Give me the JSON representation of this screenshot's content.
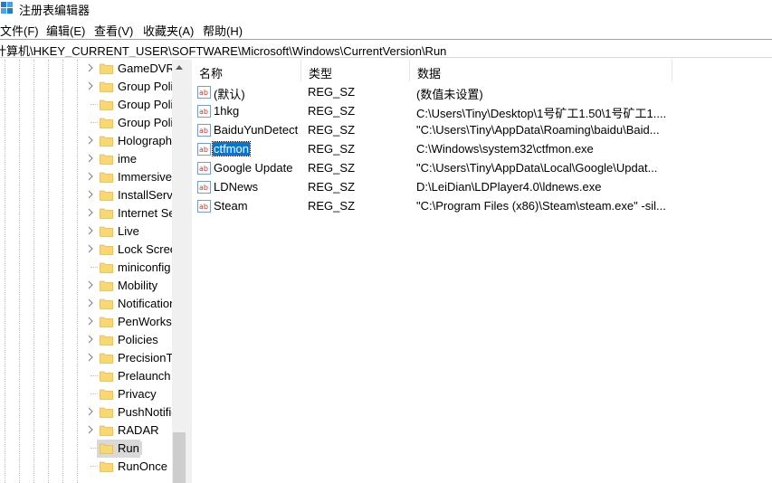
{
  "window": {
    "title": "注册表编辑器"
  },
  "menu": [
    "文件(F)",
    "编辑(E)",
    "查看(V)",
    "收藏夹(A)",
    "帮助(H)"
  ],
  "address": "计算机\\HKEY_CURRENT_USER\\SOFTWARE\\Microsoft\\Windows\\CurrentVersion\\Run",
  "tree": [
    {
      "label": "GameDVR",
      "expander": true
    },
    {
      "label": "Group Policy",
      "expander": true
    },
    {
      "label": "Group Policy",
      "expander": false
    },
    {
      "label": "Group Policy",
      "expander": false
    },
    {
      "label": "Holographic",
      "expander": true
    },
    {
      "label": "ime",
      "expander": true
    },
    {
      "label": "Immersive",
      "expander": true
    },
    {
      "label": "InstallService",
      "expander": true
    },
    {
      "label": "Internet Settings",
      "expander": true
    },
    {
      "label": "Live",
      "expander": true
    },
    {
      "label": "Lock Screen",
      "expander": true
    },
    {
      "label": "miniconfig",
      "expander": false
    },
    {
      "label": "Mobility",
      "expander": true
    },
    {
      "label": "Notifications",
      "expander": true
    },
    {
      "label": "PenWorkspace",
      "expander": true
    },
    {
      "label": "Policies",
      "expander": true
    },
    {
      "label": "PrecisionTouchPad",
      "expander": true
    },
    {
      "label": "Prelaunch",
      "expander": false
    },
    {
      "label": "Privacy",
      "expander": false
    },
    {
      "label": "PushNotifications",
      "expander": true
    },
    {
      "label": "RADAR",
      "expander": true
    },
    {
      "label": "Run",
      "expander": false,
      "selected": true
    },
    {
      "label": "RunOnce",
      "expander": false
    }
  ],
  "columns": {
    "name": "名称",
    "type": "类型",
    "data": "数据"
  },
  "values": [
    {
      "name": "(默认)",
      "type": "REG_SZ",
      "data": "(数值未设置)"
    },
    {
      "name": "1hkg",
      "type": "REG_SZ",
      "data": "C:\\Users\\Tiny\\Desktop\\1号矿工1.50\\1号矿工1...."
    },
    {
      "name": "BaiduYunDetect",
      "type": "REG_SZ",
      "data": "\"C:\\Users\\Tiny\\AppData\\Roaming\\baidu\\Baid..."
    },
    {
      "name": "ctfmon",
      "type": "REG_SZ",
      "data": "C:\\Windows\\system32\\ctfmon.exe",
      "selected": true
    },
    {
      "name": "Google Update",
      "type": "REG_SZ",
      "data": "\"C:\\Users\\Tiny\\AppData\\Local\\Google\\Updat..."
    },
    {
      "name": "LDNews",
      "type": "REG_SZ",
      "data": "D:\\LeiDian\\LDPlayer4.0\\ldnews.exe"
    },
    {
      "name": "Steam",
      "type": "REG_SZ",
      "data": "\"C:\\Program Files (x86)\\Steam\\steam.exe\" -sil..."
    }
  ],
  "colors": {
    "selection": "#0078d7",
    "folder": "#f8d775",
    "folder_dark": "#e8b84a"
  }
}
